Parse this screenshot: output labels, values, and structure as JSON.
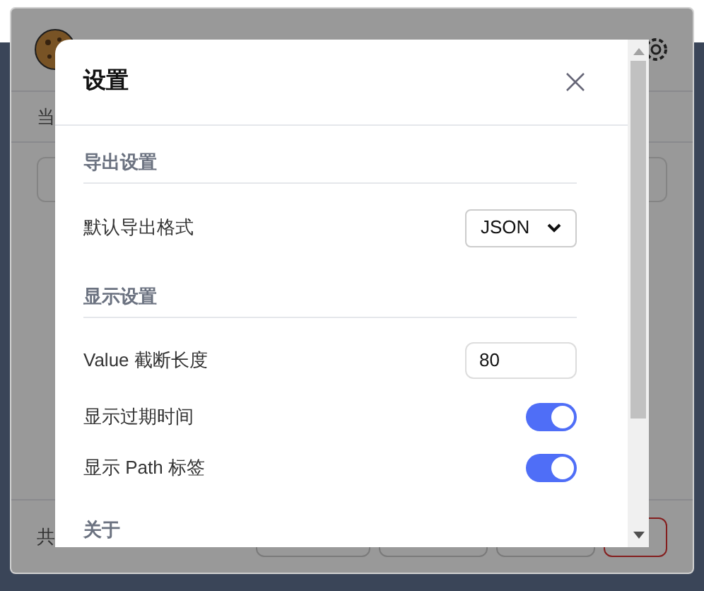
{
  "background": {
    "header_label": "当",
    "footer_label": "共"
  },
  "dialog": {
    "title": "设置",
    "sections": [
      {
        "title": "导出设置",
        "rows": [
          {
            "kind": "select",
            "label": "默认导出格式",
            "value": "JSON"
          }
        ]
      },
      {
        "title": "显示设置",
        "rows": [
          {
            "kind": "input",
            "label": "Value 截断长度",
            "value": "80"
          },
          {
            "kind": "toggle",
            "label": "显示过期时间",
            "on": true
          },
          {
            "kind": "toggle",
            "label": "显示 Path 标签",
            "on": true
          }
        ]
      },
      {
        "title": "关于"
      }
    ]
  }
}
